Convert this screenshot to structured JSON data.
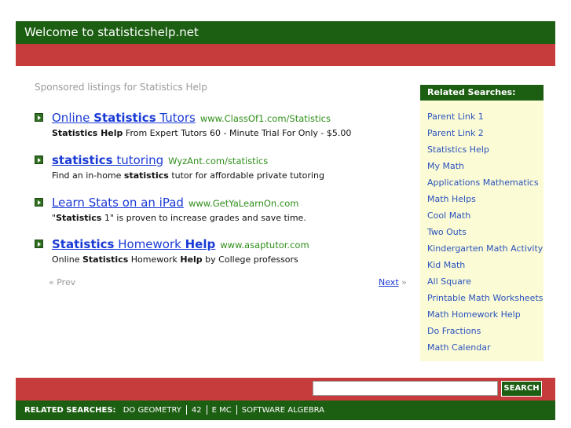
{
  "header": {
    "title": "Welcome to statisticshelp.net"
  },
  "sponsored": "Sponsored listings for Statistics Help",
  "listings": [
    {
      "title": [
        {
          "text": "Online ",
          "bold": false
        },
        {
          "text": "Statistics",
          "bold": true
        },
        {
          "text": " Tutors",
          "bold": false
        }
      ],
      "url": "www.ClassOf1.com/Statistics",
      "desc": [
        {
          "text": "Statistics Help",
          "bold": true
        },
        {
          "text": " From Expert Tutors 60 - Minute Trial For Only - $5.00",
          "bold": false
        }
      ]
    },
    {
      "title": [
        {
          "text": "statistics",
          "bold": true
        },
        {
          "text": " tutoring",
          "bold": false
        }
      ],
      "url": "WyzAnt.com/statistics",
      "desc": [
        {
          "text": "Find an in-home ",
          "bold": false
        },
        {
          "text": "statistics",
          "bold": true
        },
        {
          "text": " tutor for affordable private tutoring",
          "bold": false
        }
      ]
    },
    {
      "title": [
        {
          "text": "Learn Stats on an iPad",
          "bold": false
        }
      ],
      "url": "www.GetYaLearnOn.com",
      "desc": [
        {
          "text": "\"",
          "bold": false
        },
        {
          "text": "Statistics",
          "bold": true
        },
        {
          "text": " 1\" is proven to increase grades and save time.",
          "bold": false
        }
      ]
    },
    {
      "title": [
        {
          "text": "Statistics",
          "bold": true
        },
        {
          "text": " Homework ",
          "bold": false
        },
        {
          "text": "Help",
          "bold": true
        }
      ],
      "url": "www.asaptutor.com",
      "desc": [
        {
          "text": "Online ",
          "bold": false
        },
        {
          "text": "Statistics",
          "bold": true
        },
        {
          "text": " Homework ",
          "bold": false
        },
        {
          "text": "Help",
          "bold": true
        },
        {
          "text": " by College professors",
          "bold": false
        }
      ]
    }
  ],
  "pagination": {
    "prev": "« Prev",
    "next": "Next",
    "next_arrow": "»"
  },
  "sidebar": {
    "title": "Related Searches:",
    "items": [
      "Parent Link 1",
      "Parent Link 2",
      "Statistics Help",
      "My Math",
      "Applications Mathematics",
      "Math Helps",
      "Cool Math",
      "Two Outs",
      "Kindergarten Math Activity",
      "Kid Math",
      "All Square",
      "Printable Math Worksheets",
      "Math Homework Help",
      "Do Fractions",
      "Math Calendar"
    ]
  },
  "search": {
    "value": "",
    "button": "SEARCH"
  },
  "footer": {
    "label": "RELATED SEARCHES:",
    "links": [
      "DO GEOMETRY",
      "42",
      "E MC",
      "SOFTWARE ALGEBRA"
    ]
  },
  "colors": {
    "green": "#1c5e12",
    "red": "#c63c3c",
    "link_blue": "#1a3ad6",
    "url_green": "#2f8f1a",
    "sidebar_bg": "#fbfbd5"
  }
}
